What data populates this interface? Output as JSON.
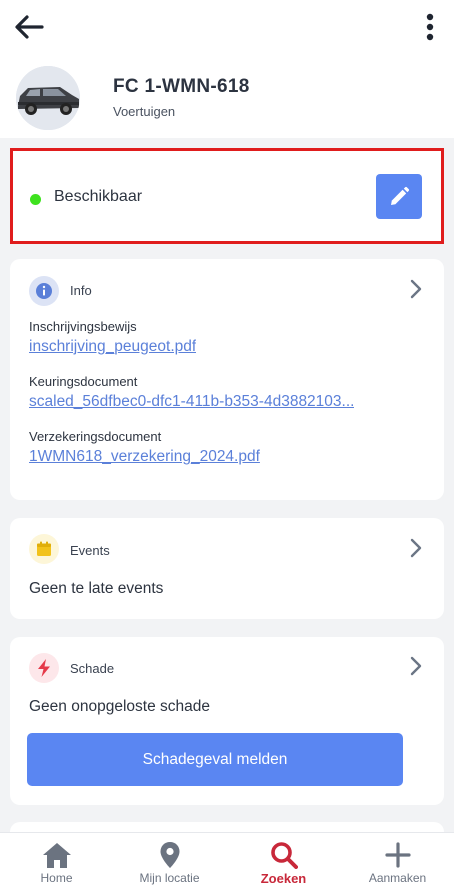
{
  "header": {
    "title": "FC 1-WMN-618",
    "subtitle": "Voertuigen",
    "back_icon": "arrow-left-icon",
    "more_icon": "more-vertical-icon"
  },
  "status": {
    "label": "Beschikbaar",
    "dot_color": "#3ee21e",
    "highlight_color": "#e01d1d",
    "edit_icon": "pencil-icon"
  },
  "info_card": {
    "title": "Info",
    "icon": "info-icon",
    "documents": [
      {
        "label": "Inschrijvingsbewijs",
        "file": "inschrijving_peugeot.pdf"
      },
      {
        "label": "Keuringsdocument",
        "file": "scaled_56dfbec0-dfc1-411b-b353-4d3882103..."
      },
      {
        "label": "Verzekeringsdocument",
        "file": "1WMN618_verzekering_2024.pdf"
      }
    ]
  },
  "events_card": {
    "title": "Events",
    "icon": "calendar-icon",
    "body": "Geen te late events"
  },
  "damage_card": {
    "title": "Schade",
    "icon": "lightning-icon",
    "body": "Geen onopgeloste schade",
    "button_label": "Schadegeval melden"
  },
  "bottom_nav": {
    "items": [
      {
        "label": "Home",
        "icon": "home-icon"
      },
      {
        "label": "Mijn locatie",
        "icon": "location-pin-icon"
      },
      {
        "label": "Zoeken",
        "icon": "search-icon",
        "active": true
      },
      {
        "label": "Aanmaken",
        "icon": "plus-icon"
      }
    ]
  },
  "colors": {
    "accent": "#5a86f2",
    "active_nav": "#c8283a",
    "link": "#5b80d9"
  }
}
